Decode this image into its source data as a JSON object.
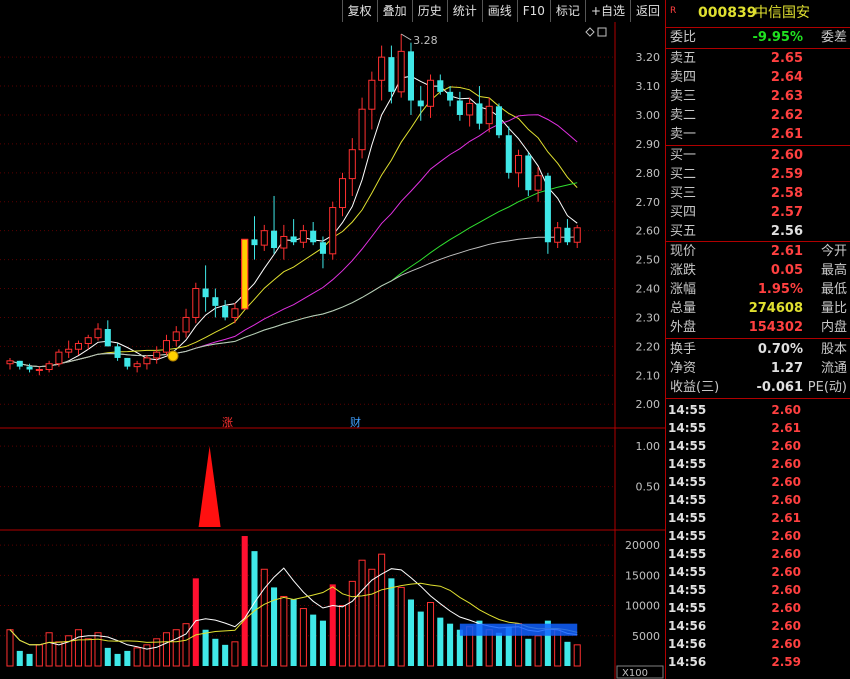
{
  "toolbar": {
    "items": [
      "复权",
      "叠加",
      "历史",
      "统计",
      "画线",
      "F10",
      "标记",
      "+自选",
      "返回"
    ]
  },
  "stock": {
    "badge": "R",
    "code": "000839",
    "name": "中信国安"
  },
  "order_book": {
    "ratio_label": "委比",
    "ratio_value": "-9.95%",
    "diff_label": "委差",
    "asks": [
      {
        "label": "卖五",
        "price": "2.65"
      },
      {
        "label": "卖四",
        "price": "2.64"
      },
      {
        "label": "卖三",
        "price": "2.63"
      },
      {
        "label": "卖二",
        "price": "2.62"
      },
      {
        "label": "卖一",
        "price": "2.61"
      }
    ],
    "bids": [
      {
        "label": "买一",
        "price": "2.60"
      },
      {
        "label": "买二",
        "price": "2.59"
      },
      {
        "label": "买三",
        "price": "2.58"
      },
      {
        "label": "买四",
        "price": "2.57"
      },
      {
        "label": "买五",
        "price": "2.56"
      }
    ]
  },
  "quote": {
    "rows": [
      {
        "label": "现价",
        "value": "2.61",
        "label2": "今开",
        "color": "#ff4040"
      },
      {
        "label": "涨跌",
        "value": "0.05",
        "label2": "最高",
        "color": "#ff4040"
      },
      {
        "label": "涨幅",
        "value": "1.95%",
        "label2": "最低",
        "color": "#ff4040"
      },
      {
        "label": "总量",
        "value": "274608",
        "label2": "量比",
        "color": "#e0e030"
      },
      {
        "label": "外盘",
        "value": "154302",
        "label2": "内盘",
        "color": "#ff4040"
      }
    ],
    "rows2": [
      {
        "label": "换手",
        "value": "0.70%",
        "label2": "股本",
        "color": "#e0e0e0"
      },
      {
        "label": "净资",
        "value": "1.27",
        "label2": "流通",
        "color": "#e0e0e0"
      },
      {
        "label": "收益(三)",
        "value": "-0.061",
        "label2": "PE(动)",
        "color": "#e0e0e0"
      }
    ]
  },
  "ticks": [
    {
      "time": "14:55",
      "price": "2.60"
    },
    {
      "time": "14:55",
      "price": "2.61"
    },
    {
      "time": "14:55",
      "price": "2.60"
    },
    {
      "time": "14:55",
      "price": "2.60"
    },
    {
      "time": "14:55",
      "price": "2.60"
    },
    {
      "time": "14:55",
      "price": "2.60"
    },
    {
      "time": "14:55",
      "price": "2.61"
    },
    {
      "time": "14:55",
      "price": "2.60"
    },
    {
      "time": "14:55",
      "price": "2.60"
    },
    {
      "time": "14:55",
      "price": "2.60"
    },
    {
      "time": "14:55",
      "price": "2.60"
    },
    {
      "time": "14:55",
      "price": "2.60"
    },
    {
      "time": "14:56",
      "price": "2.60"
    },
    {
      "time": "14:56",
      "price": "2.60"
    },
    {
      "time": "14:56",
      "price": "2.59"
    }
  ],
  "chart_data": [
    {
      "type": "candlestick",
      "title": "",
      "ylim": [
        1.98,
        3.28
      ],
      "yticks": [
        "3.20",
        "3.10",
        "3.00",
        "2.90",
        "2.80",
        "2.70",
        "2.60",
        "2.50",
        "2.40",
        "2.30",
        "2.20",
        "2.10",
        "2.00"
      ],
      "annotation_high": "3.28",
      "markers": [
        "涨",
        "财"
      ],
      "candles": [
        [
          2.14,
          2.16,
          2.12,
          2.15
        ],
        [
          2.15,
          2.15,
          2.12,
          2.13
        ],
        [
          2.13,
          2.14,
          2.11,
          2.12
        ],
        [
          2.12,
          2.13,
          2.1,
          2.12
        ],
        [
          2.12,
          2.15,
          2.11,
          2.14
        ],
        [
          2.14,
          2.19,
          2.13,
          2.18
        ],
        [
          2.18,
          2.22,
          2.16,
          2.19
        ],
        [
          2.19,
          2.22,
          2.17,
          2.21
        ],
        [
          2.21,
          2.24,
          2.19,
          2.23
        ],
        [
          2.23,
          2.28,
          2.22,
          2.26
        ],
        [
          2.26,
          2.29,
          2.2,
          2.2
        ],
        [
          2.2,
          2.21,
          2.15,
          2.16
        ],
        [
          2.16,
          2.16,
          2.12,
          2.13
        ],
        [
          2.13,
          2.15,
          2.11,
          2.14
        ],
        [
          2.14,
          2.17,
          2.12,
          2.16
        ],
        [
          2.16,
          2.2,
          2.14,
          2.18
        ],
        [
          2.18,
          2.24,
          2.17,
          2.22
        ],
        [
          2.22,
          2.27,
          2.2,
          2.25
        ],
        [
          2.25,
          2.33,
          2.23,
          2.3
        ],
        [
          2.3,
          2.42,
          2.28,
          2.4
        ],
        [
          2.4,
          2.48,
          2.32,
          2.37
        ],
        [
          2.37,
          2.4,
          2.3,
          2.34
        ],
        [
          2.34,
          2.36,
          2.29,
          2.3
        ],
        [
          2.3,
          2.35,
          2.28,
          2.33
        ],
        [
          2.33,
          2.57,
          2.33,
          2.57
        ],
        [
          2.57,
          2.65,
          2.5,
          2.55
        ],
        [
          2.55,
          2.62,
          2.53,
          2.6
        ],
        [
          2.6,
          2.72,
          2.52,
          2.54
        ],
        [
          2.54,
          2.62,
          2.5,
          2.58
        ],
        [
          2.58,
          2.64,
          2.55,
          2.56
        ],
        [
          2.56,
          2.62,
          2.54,
          2.6
        ],
        [
          2.6,
          2.63,
          2.55,
          2.56
        ],
        [
          2.56,
          2.58,
          2.47,
          2.52
        ],
        [
          2.52,
          2.7,
          2.5,
          2.68
        ],
        [
          2.68,
          2.8,
          2.65,
          2.78
        ],
        [
          2.78,
          2.92,
          2.72,
          2.88
        ],
        [
          2.88,
          3.06,
          2.85,
          3.02
        ],
        [
          3.02,
          3.15,
          2.95,
          3.12
        ],
        [
          3.12,
          3.24,
          3.05,
          3.2
        ],
        [
          3.2,
          3.24,
          3.04,
          3.08
        ],
        [
          3.08,
          3.28,
          3.06,
          3.22
        ],
        [
          3.22,
          3.25,
          3.0,
          3.05
        ],
        [
          3.05,
          3.1,
          2.98,
          3.03
        ],
        [
          3.03,
          3.14,
          2.99,
          3.12
        ],
        [
          3.12,
          3.14,
          3.07,
          3.08
        ],
        [
          3.08,
          3.1,
          3.03,
          3.05
        ],
        [
          3.05,
          3.08,
          2.98,
          3.0
        ],
        [
          3.0,
          3.06,
          2.96,
          3.04
        ],
        [
          3.04,
          3.1,
          2.95,
          2.97
        ],
        [
          2.97,
          3.06,
          2.94,
          3.03
        ],
        [
          3.03,
          3.04,
          2.92,
          2.93
        ],
        [
          2.93,
          2.96,
          2.78,
          2.8
        ],
        [
          2.8,
          2.88,
          2.75,
          2.86
        ],
        [
          2.86,
          2.87,
          2.72,
          2.74
        ],
        [
          2.74,
          2.82,
          2.7,
          2.79
        ],
        [
          2.79,
          2.8,
          2.52,
          2.56
        ],
        [
          2.56,
          2.63,
          2.54,
          2.61
        ],
        [
          2.61,
          2.64,
          2.55,
          2.56
        ],
        [
          2.56,
          2.62,
          2.54,
          2.61
        ]
      ]
    },
    {
      "type": "indicator",
      "yticks": [
        "1.00",
        "0.50"
      ],
      "ylim": [
        0,
        1.2
      ],
      "signal_index": 20,
      "signal_value": 1.0
    },
    {
      "type": "bar",
      "title": "",
      "yticks": [
        "20000",
        "15000",
        "10000",
        "5000"
      ],
      "unit": "X100",
      "ylim": [
        0,
        22000
      ],
      "volumes": [
        6000,
        2500,
        2000,
        3500,
        5500,
        4000,
        5000,
        6000,
        4500,
        5500,
        3000,
        2000,
        2500,
        3000,
        3500,
        4500,
        5500,
        6000,
        7000,
        14500,
        6000,
        4500,
        3500,
        4000,
        21500,
        19000,
        16000,
        13000,
        11500,
        11000,
        9500,
        8500,
        7500,
        13500,
        10000,
        14000,
        17500,
        16000,
        18500,
        14500,
        13000,
        11000,
        9000,
        10500,
        8000,
        7000,
        6000,
        6500,
        7500,
        6000,
        5500,
        6500,
        7000,
        4500,
        5000,
        7500,
        6000,
        4000,
        3500
      ],
      "highlight_bars": [
        19,
        24,
        33
      ],
      "legend_color_up": "#ff3030",
      "legend_color_down": "#40e8e8"
    }
  ]
}
